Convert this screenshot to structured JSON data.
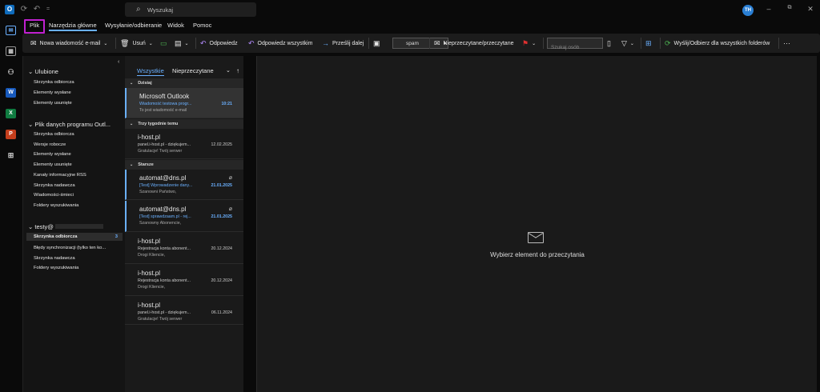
{
  "titlebar": {
    "search_placeholder": "Wyszukaj",
    "avatar_initials": "TH"
  },
  "ribbon_tabs": [
    {
      "label": "Plik"
    },
    {
      "label": "Narzędzia główne"
    },
    {
      "label": "Wysyłanie/odbieranie"
    },
    {
      "label": "Widok"
    },
    {
      "label": "Pomoc"
    }
  ],
  "toolbar": {
    "new_email": "Nowa wiadomość e-mail",
    "delete": "Usuń",
    "reply": "Odpowiedz",
    "reply_all": "Odpowiedz wszystkim",
    "forward": "Prześlij dalej",
    "move_target": "spam",
    "unread_read": "Nieprzeczytane/przeczytane",
    "people_search_placeholder": "Szukaj osób",
    "send_receive_all": "Wyślij/Odbierz dla wszystkich folderów",
    "more": "···"
  },
  "folders": {
    "favorites_title": "Ulubione",
    "favorites": [
      "Skrzynka odbiorcza",
      "Elementy wysłane",
      "Elementy usunięte"
    ],
    "datafile_title": "Plik danych programu Outl...",
    "datafile": [
      "Skrzynka odbiorcza",
      "Wersje robocze",
      "Elementy wysłane",
      "Elementy usunięte",
      "Kanały informacyjne RSS",
      "Skrzynka nadawcza",
      "Wiadomości-śmieci",
      "Foldery wyszukiwania"
    ],
    "account_title": "testy@",
    "account_inbox": "Skrzynka odbiorcza",
    "account_inbox_count": "3",
    "account_items": [
      "Błędy synchronizacji (tylko ten ko...",
      "Skrzynka nadawcza",
      "Foldery wyszukiwania"
    ]
  },
  "list": {
    "tab_all": "Wszystkie",
    "tab_unread": "Nieprzeczytane",
    "group_today": "Dzisiaj",
    "group_three_weeks": "Trzy tygodnie temu",
    "group_older": "Starsze",
    "messages": [
      {
        "from": "Microsoft Outlook",
        "subject": "Wiadomość testowa progr...",
        "preview": "To jest wiadomość e-mail",
        "date": "10:21"
      },
      {
        "from": "i-host.pl",
        "subject": "panel.i-host.pl - dziękujem...",
        "preview": "Gratulacje! Twój serwer",
        "date": "12.02.2025"
      },
      {
        "from": "automat@dns.pl",
        "subject": "[Test] Wprowadzenie dany...",
        "preview": "Szanowni Państwo,",
        "date": "21.01.2025"
      },
      {
        "from": "automat@dns.pl",
        "subject": "[Test] sprawdzaam.pl - rej...",
        "preview": "Szanowny Abonencie,",
        "date": "21.01.2025"
      },
      {
        "from": "i-host.pl",
        "subject": "Rejestracja konta abonent...",
        "preview": "Drogi Kliencie,",
        "date": "20.12.2024"
      },
      {
        "from": "i-host.pl",
        "subject": "Rejestracja konta abonent...",
        "preview": "Drogi Kliencie,",
        "date": "20.12.2024"
      },
      {
        "from": "i-host.pl",
        "subject": "panel.i-host.pl - dziękujem...",
        "preview": "Gratulacje! Twój serwer",
        "date": "06.11.2024"
      }
    ]
  },
  "reading": {
    "empty_text": "Wybierz element do przeczytania"
  },
  "colors": {
    "accent": "#6ab0ff",
    "highlight": "#c020d0"
  }
}
